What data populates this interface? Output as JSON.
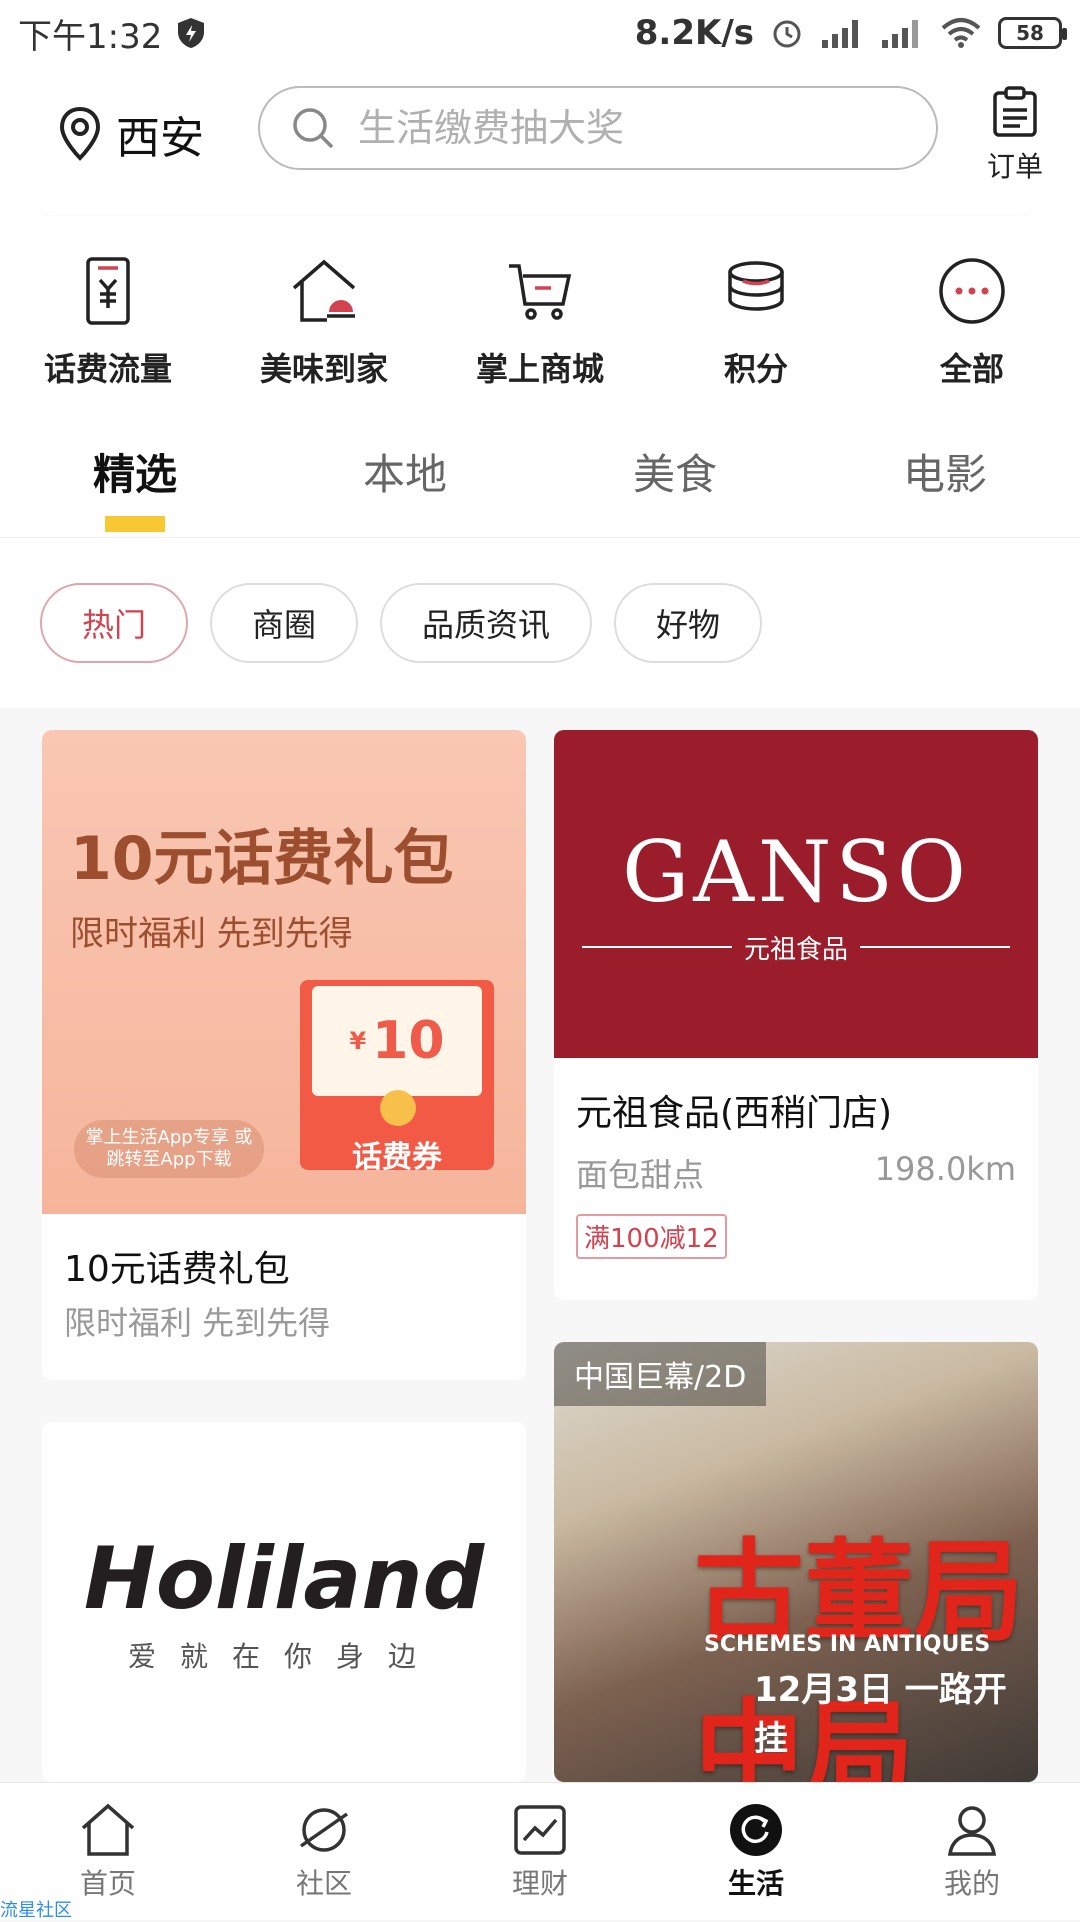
{
  "status_bar": {
    "time": "下午1:32",
    "network_speed": "8.2K/s",
    "battery": "58"
  },
  "header": {
    "location": "西安",
    "search_placeholder": "生活缴费抽大奖",
    "orders_label": "订单"
  },
  "quick_menu": [
    {
      "label": "话费流量",
      "icon": "phone-bill-icon"
    },
    {
      "label": "美味到家",
      "icon": "home-dining-icon"
    },
    {
      "label": "掌上商城",
      "icon": "shopping-cart-icon"
    },
    {
      "label": "积分",
      "icon": "coins-icon"
    },
    {
      "label": "全部",
      "icon": "more-dots-icon"
    }
  ],
  "tabs": [
    "精选",
    "本地",
    "美食",
    "电影"
  ],
  "active_tab": "精选",
  "chips": [
    "热门",
    "商圈",
    "品质资讯",
    "好物"
  ],
  "active_chip": "热门",
  "cards": {
    "promo": {
      "banner_title": "10元话费礼包",
      "banner_sub": "限时福利 先到先得",
      "badge": "掌上生活App专享 或跳转至App下载",
      "voucher_value": "10",
      "voucher_currency": "¥",
      "voucher_label": "话费券",
      "title": "10元话费礼包",
      "subtitle": "限时福利 先到先得"
    },
    "ganso": {
      "logo": "GANSO",
      "logo_cn": "元祖食品",
      "title": "元祖食品(西稍门店)",
      "category": "面包甜点",
      "distance": "198.0km",
      "tag": "满100减12"
    },
    "holiland": {
      "logo": "Holiland",
      "slogan": "爱就在你身边"
    },
    "movie": {
      "chip": "中国巨幕/2D",
      "title": "古董局中局",
      "title_en": "SCHEMES IN ANTIQUES",
      "release": "12月3日 一路开挂"
    }
  },
  "bottom_nav": [
    {
      "label": "首页",
      "icon": "home-icon"
    },
    {
      "label": "社区",
      "icon": "planet-icon"
    },
    {
      "label": "理财",
      "icon": "chart-icon"
    },
    {
      "label": "生活",
      "icon": "life-icon"
    },
    {
      "label": "我的",
      "icon": "user-icon"
    }
  ],
  "active_nav": "生活",
  "overlay_label": "流星社区"
}
